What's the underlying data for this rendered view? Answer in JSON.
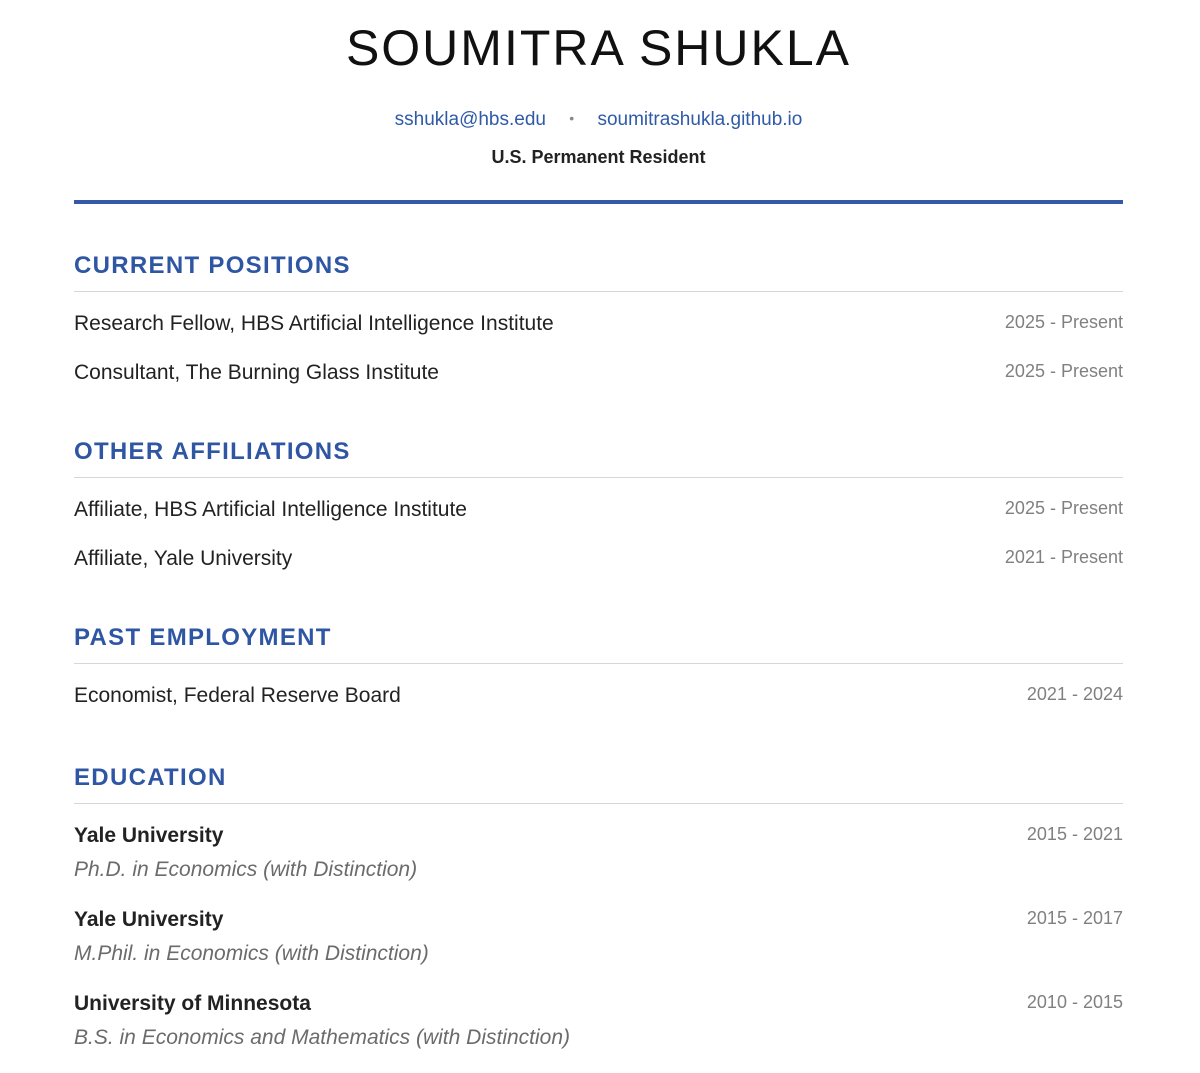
{
  "header": {
    "name": "SOUMITRA SHUKLA",
    "email": "sshukla@hbs.edu",
    "separator": "•",
    "website": "soumitrashukla.github.io",
    "residency": "U.S. Permanent Resident"
  },
  "colors": {
    "accent": "#2f56a3",
    "link": "#2f5aa8",
    "date_text": "#808080",
    "degree_text": "#6b6b6b"
  },
  "sections": {
    "current_positions": {
      "title": "CURRENT POSITIONS",
      "entries": [
        {
          "title": "Research Fellow, HBS Artificial Intelligence Institute",
          "dates": "2025 - Present"
        },
        {
          "title": "Consultant, The Burning Glass Institute",
          "dates": "2025 - Present"
        }
      ]
    },
    "other_affiliations": {
      "title": "OTHER AFFILIATIONS",
      "entries": [
        {
          "title": "Affiliate, HBS Artificial Intelligence Institute",
          "dates": "2025 - Present"
        },
        {
          "title": "Affiliate, Yale University",
          "dates": "2021 - Present"
        }
      ]
    },
    "past_employment": {
      "title": "PAST EMPLOYMENT",
      "entries": [
        {
          "title": "Economist, Federal Reserve Board",
          "dates": "2021 - 2024"
        }
      ]
    },
    "education": {
      "title": "EDUCATION",
      "entries": [
        {
          "school": "Yale University",
          "degree": "Ph.D. in Economics (with Distinction)",
          "dates": "2015 - 2021"
        },
        {
          "school": "Yale University",
          "degree": "M.Phil. in Economics (with Distinction)",
          "dates": "2015 - 2017"
        },
        {
          "school": "University of Minnesota",
          "degree": "B.S. in Economics and Mathematics (with Distinction)",
          "dates": "2010 - 2015"
        }
      ]
    }
  }
}
